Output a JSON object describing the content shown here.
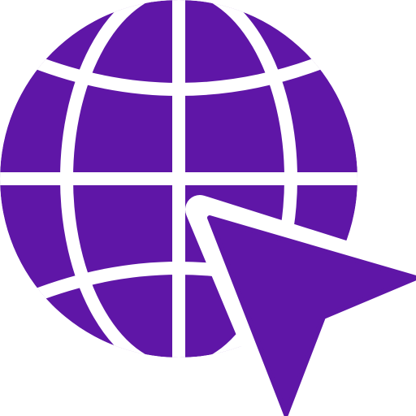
{
  "icon": {
    "name": "globe-with-cursor-icon",
    "parts": [
      "globe-icon",
      "cursor-arrow-icon"
    ],
    "color": "#5f16a7",
    "background": "#ffffff"
  }
}
